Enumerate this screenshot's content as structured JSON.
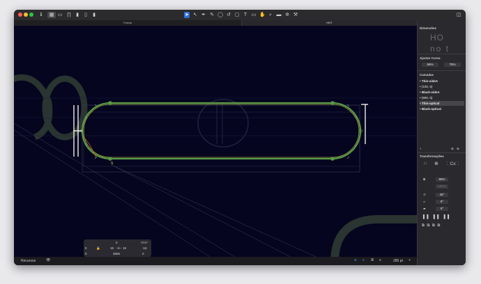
{
  "tabs": [
    "Forma",
    "HOT"
  ],
  "preview": {
    "line1": "HO",
    "line2": "no t"
  },
  "panel": {
    "sections": {
      "dimensions": "Dimensões",
      "curve": "Ajustar Curva",
      "layers": "Camadas",
      "transforms": "Transformações"
    },
    "curve": {
      "a": "56%",
      "b": "75%"
    },
    "layers": [
      "Thin-sideA",
      "{100, 5}",
      "Black-sideA",
      "{900, 5}",
      "Thin-optical",
      "Black-optical"
    ],
    "transform": {
      "scale": "90%",
      "scale2": "100%",
      "rotate": "45°",
      "skew1": "9°",
      "skew2": "9°"
    }
  },
  "info": {
    "top": "0",
    "tag": "004F",
    "x": "0",
    "w1": "15",
    "w2": "15",
    "dist": "-16",
    "y": "0",
    "len": "3655",
    "h": "0"
  },
  "status": {
    "left": "Recursos",
    "zoom": "285 pt"
  },
  "icons": {
    "eye": "eye-icon",
    "lock": "lock-icon",
    "pen": "pen-icon",
    "pointer": "pointer-icon"
  },
  "colors": {
    "canvas": "#05051f",
    "path": "#5a9a45",
    "accent": "#d8e04a"
  }
}
